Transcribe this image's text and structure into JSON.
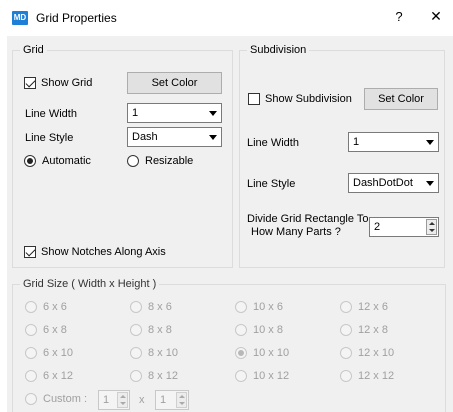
{
  "titlebar": {
    "icon_text": "MD",
    "title": "Grid Properties",
    "help": "?",
    "close": "✕"
  },
  "grid_group": {
    "title": "Grid",
    "show_grid_label": "Show Grid",
    "show_grid_checked": true,
    "set_color_label": "Set Color",
    "line_width_label": "Line Width",
    "line_width_value": "1",
    "line_style_label": "Line Style",
    "line_style_value": "Dash",
    "automatic_label": "Automatic",
    "resizable_label": "Resizable",
    "selected_mode": "Automatic",
    "show_notches_label": "Show Notches Along Axis",
    "show_notches_checked": true
  },
  "subdivision_group": {
    "title": "Subdivision",
    "show_subdivision_label": "Show Subdivision",
    "show_subdivision_checked": false,
    "set_color_label": "Set Color",
    "line_width_label": "Line Width",
    "line_width_value": "1",
    "line_style_label": "Line Style",
    "line_style_value": "DashDotDot",
    "divide_label_line1": "Divide Grid Rectangle To",
    "divide_label_line2": "How Many Parts ?",
    "divide_value": "2"
  },
  "grid_size_group": {
    "title": "Grid Size ( Width x Height )",
    "rows": [
      [
        "6 x 6",
        "8 x 6",
        "10 x 6",
        "12 x 6"
      ],
      [
        "6 x 8",
        "8 x 8",
        "10 x 8",
        "12 x 8"
      ],
      [
        "6 x 10",
        "8 x 10",
        "10 x 10",
        "12 x 10"
      ],
      [
        "6 x 12",
        "8 x 12",
        "10 x 12",
        "12 x 12"
      ]
    ],
    "selected": "10 x 10",
    "custom_label": "Custom :",
    "custom_width": "1",
    "custom_x": "x",
    "custom_height": "1"
  }
}
